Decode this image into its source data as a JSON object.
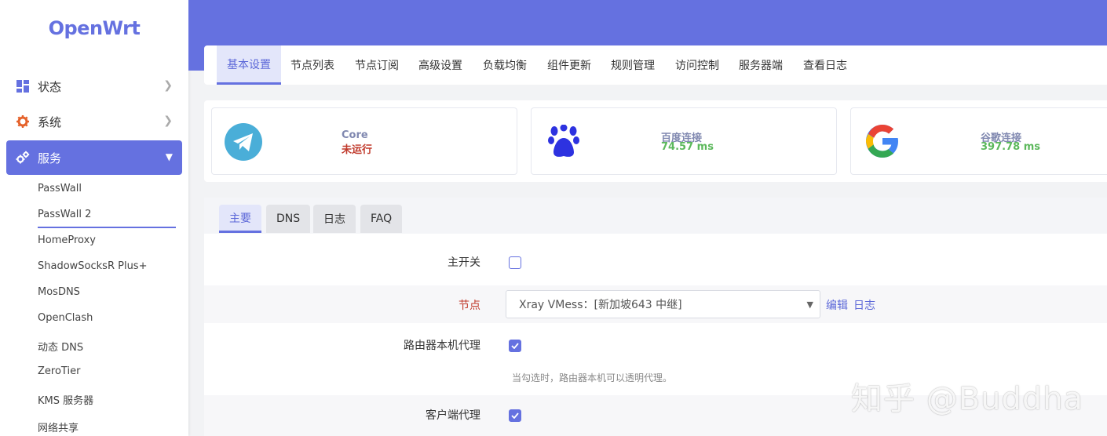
{
  "brand": "OpenWrt",
  "sidebar": {
    "items": [
      {
        "label": "状态",
        "icon": "dashboard-icon"
      },
      {
        "label": "系统",
        "icon": "gear-icon"
      },
      {
        "label": "服务",
        "icon": "gears-icon"
      }
    ],
    "sub_items": [
      "PassWall",
      "PassWall 2",
      "HomeProxy",
      "ShadowSocksR Plus+",
      "MosDNS",
      "OpenClash",
      "动态 DNS",
      "ZeroTier",
      "KMS 服务器",
      "网络共享"
    ]
  },
  "tabs": [
    "基本设置",
    "节点列表",
    "节点订阅",
    "高级设置",
    "负载均衡",
    "组件更新",
    "规则管理",
    "访问控制",
    "服务器端",
    "查看日志"
  ],
  "status_cards": [
    {
      "label": "Core",
      "value": "未运行",
      "value_color": "#c0392b",
      "icon": "telegram-icon"
    },
    {
      "label": "百度连接",
      "value": "74.57 ms",
      "value_color": "#5cb85c",
      "icon": "paw-icon"
    },
    {
      "label": "谷歌连接",
      "value": "397.78 ms",
      "value_color": "#5cb85c",
      "icon": "google-icon"
    }
  ],
  "subtabs": [
    "主要",
    "DNS",
    "日志",
    "FAQ"
  ],
  "form": {
    "main_switch_label": "主开关",
    "node_label": "节点",
    "node_value": "Xray VMess：[新加坡643 中继]",
    "edit_link": "编辑",
    "log_link": "日志",
    "router_proxy_label": "路由器本机代理",
    "router_proxy_help": "当勾选时，路由器本机可以透明代理。",
    "client_proxy_label": "客户端代理"
  },
  "watermark": "知乎 @Buddha",
  "colors": {
    "accent": "#6571e0",
    "error": "#c0392b",
    "success": "#5cb85c"
  }
}
